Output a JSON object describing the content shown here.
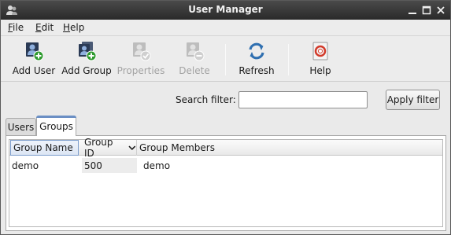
{
  "window": {
    "title": "User Manager",
    "controls": [
      "minimize",
      "maximize",
      "close"
    ]
  },
  "menubar": {
    "items": [
      {
        "label": "File"
      },
      {
        "label": "Edit"
      },
      {
        "label": "Help"
      }
    ]
  },
  "toolbar": {
    "buttons": [
      {
        "label": "Add User",
        "icon": "add-user-icon",
        "enabled": true
      },
      {
        "label": "Add Group",
        "icon": "add-group-icon",
        "enabled": true
      },
      {
        "label": "Properties",
        "icon": "properties-icon",
        "enabled": false
      },
      {
        "label": "Delete",
        "icon": "delete-icon",
        "enabled": false
      },
      {
        "label": "Refresh",
        "icon": "refresh-icon",
        "enabled": true
      },
      {
        "label": "Help",
        "icon": "help-icon",
        "enabled": true
      }
    ]
  },
  "search": {
    "label": "Search filter:",
    "value": "",
    "placeholder": "",
    "apply_label": "Apply filter"
  },
  "tabs": [
    {
      "label": "Users",
      "active": false
    },
    {
      "label": "Groups",
      "active": true
    }
  ],
  "table": {
    "columns": [
      {
        "label": "Group Name",
        "focused": true
      },
      {
        "label": "Group ID",
        "sorted": "descending"
      },
      {
        "label": "Group Members"
      }
    ],
    "rows": [
      {
        "group_name": "demo",
        "group_id": "500",
        "members": "demo"
      }
    ]
  },
  "colors": {
    "titlebar": "#2f2f2f",
    "tab_accent": "#6b8fc4",
    "add_badge": "#2e9a2e",
    "refresh_blue": "#2f6fb0"
  }
}
